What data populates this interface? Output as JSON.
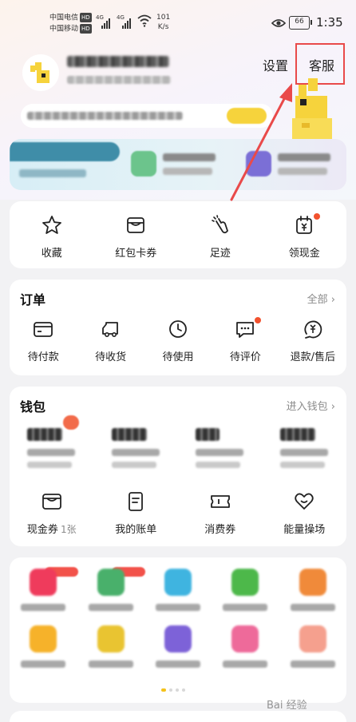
{
  "status_bar": {
    "carrier_1": "中国电信",
    "carrier_2": "中国移动",
    "hd_badge": "HD",
    "net_type": "4G",
    "speed_value": "101",
    "speed_unit": "K/s",
    "battery": "66",
    "time": "1:35"
  },
  "header": {
    "settings_label": "设置",
    "service_label": "客服"
  },
  "quick_actions": [
    {
      "label": "收藏",
      "icon": "star-icon"
    },
    {
      "label": "红包卡券",
      "icon": "coupon-icon"
    },
    {
      "label": "足迹",
      "icon": "footprint-icon"
    },
    {
      "label": "领现金",
      "icon": "cash-calendar-icon"
    }
  ],
  "orders": {
    "title": "订单",
    "more": "全部 ›",
    "items": [
      {
        "label": "待付款",
        "icon": "wallet-icon"
      },
      {
        "label": "待收货",
        "icon": "truck-icon"
      },
      {
        "label": "待使用",
        "icon": "clock-icon"
      },
      {
        "label": "待评价",
        "icon": "comment-icon"
      },
      {
        "label": "退款/售后",
        "icon": "refund-icon"
      }
    ]
  },
  "wallet": {
    "title": "钱包",
    "more": "进入钱包 ›",
    "items": [
      {
        "label": "现金券",
        "count": "1张",
        "icon": "cash-coupon-icon"
      },
      {
        "label": "我的账单",
        "icon": "bill-icon"
      },
      {
        "label": "消费券",
        "icon": "ticket-icon"
      },
      {
        "label": "能量操场",
        "icon": "heart-icon"
      }
    ]
  },
  "watermark": "Bai 经验",
  "colors": {
    "accent_yellow": "#f6d33c",
    "badge_red": "#f2522e",
    "annotation_red": "#e94a4a"
  }
}
